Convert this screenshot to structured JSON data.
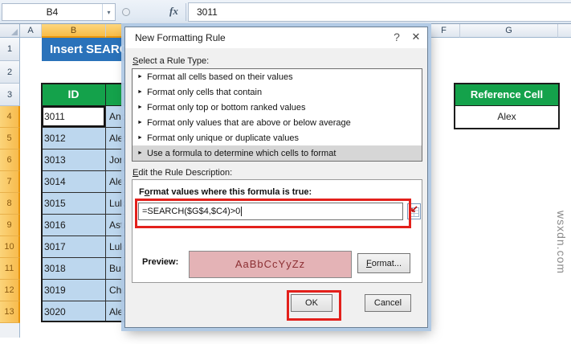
{
  "formula_bar": {
    "name_box_value": "B4",
    "dropdown_icon": "▾",
    "fx_label": "fx",
    "formula_value": "3011"
  },
  "sheet": {
    "column_headers": {
      "a": "A",
      "b": "B",
      "f": "F",
      "g": "G"
    },
    "row_numbers": [
      "1",
      "2",
      "3",
      "4",
      "5",
      "6",
      "7",
      "8",
      "9",
      "10",
      "11",
      "12",
      "13"
    ],
    "banner_title": "Insert SEARC",
    "id_header": "ID",
    "rows": [
      {
        "id": "3011",
        "name": "And"
      },
      {
        "id": "3012",
        "name": "Alex"
      },
      {
        "id": "3013",
        "name": "Jord"
      },
      {
        "id": "3014",
        "name": "Alex"
      },
      {
        "id": "3015",
        "name": "Luke"
      },
      {
        "id": "3016",
        "name": "Astr"
      },
      {
        "id": "3017",
        "name": "Luke"
      },
      {
        "id": "3018",
        "name": "Bun"
      },
      {
        "id": "3019",
        "name": "Chu"
      },
      {
        "id": "3020",
        "name": "Alex"
      }
    ],
    "reference_header": "Reference Cell",
    "reference_value": "Alex"
  },
  "dialog": {
    "title": "New Formatting Rule",
    "help_icon": "?",
    "close_icon": "✕",
    "select_rule_label": {
      "u": "S",
      "rest": "elect a Rule Type:"
    },
    "rule_types": [
      "Format all cells based on their values",
      "Format only cells that contain",
      "Format only top or bottom ranked values",
      "Format only values that are above or below average",
      "Format only unique or duplicate values",
      "Use a formula to determine which cells to format"
    ],
    "selected_rule_index": 5,
    "edit_rule_label": {
      "u": "E",
      "rest": "dit the Rule Description:"
    },
    "formula_label": {
      "pre": "F",
      "u": "o",
      "rest": "rmat values where this formula is true:"
    },
    "formula_value": "=SEARCH($G$4,$C4)>0",
    "preview_label": "Preview:",
    "preview_text": "AaBbCcYyZz",
    "format_button": {
      "u": "F",
      "rest": "ormat..."
    },
    "ok_button": "OK",
    "cancel_button": "Cancel"
  },
  "watermark": "wsxdn.com",
  "colors": {
    "banner_blue": "#2a72ba",
    "header_green": "#14a24b",
    "row_light_blue": "#bdd7ee",
    "selected_header_amber": "#f8c55d",
    "preview_pink": "#e4b3b6",
    "preview_text_red": "#8c2f33",
    "annotation_red": "#e3201b"
  }
}
